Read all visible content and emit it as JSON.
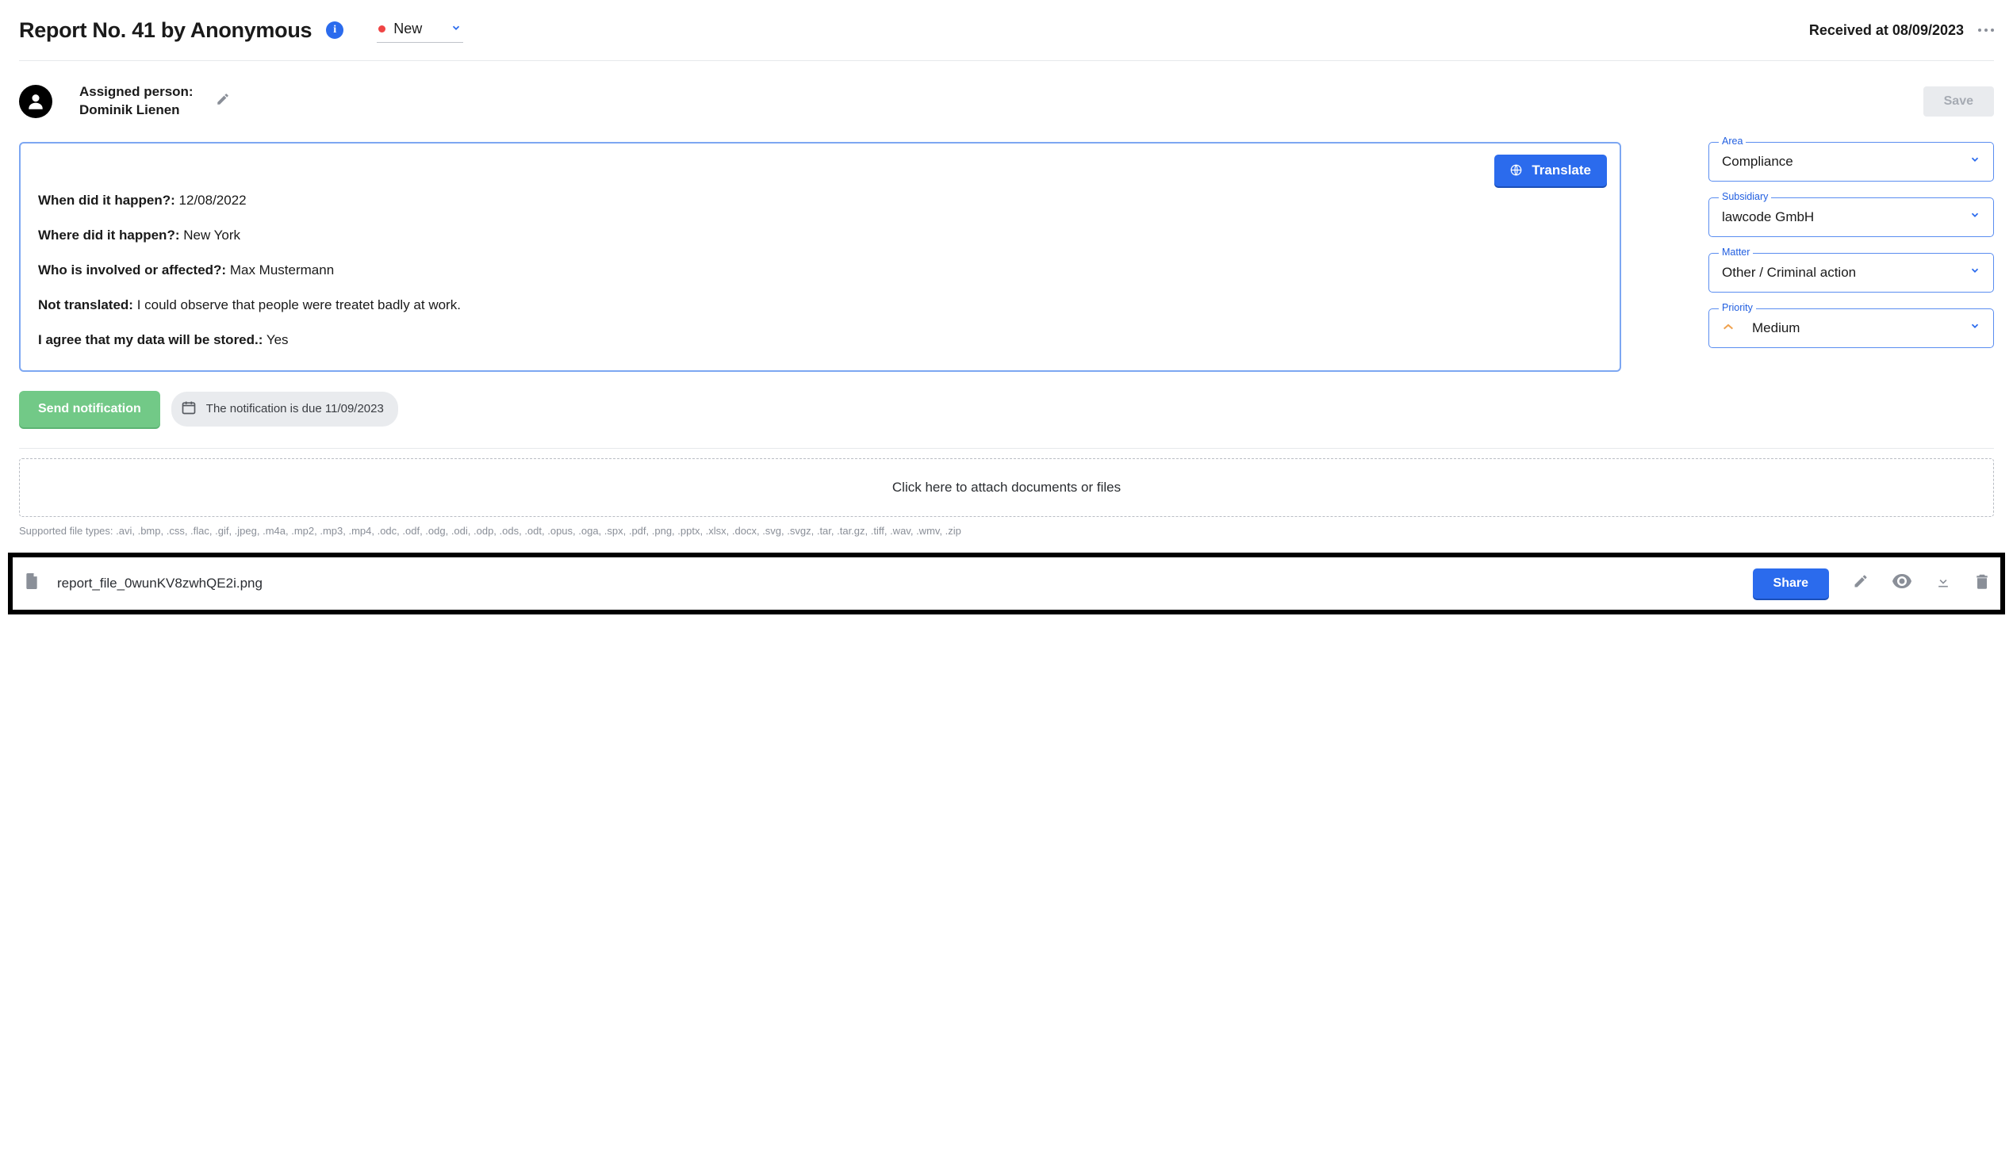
{
  "header": {
    "title": "Report No. 41 by Anonymous",
    "status_label": "New",
    "received_prefix": "Received at ",
    "received_date": "08/09/2023"
  },
  "assignee": {
    "label": "Assigned person:",
    "name": "Dominik Lienen"
  },
  "actions": {
    "save": "Save",
    "translate": "Translate",
    "send_notification": "Send notification",
    "share": "Share"
  },
  "notification_due": {
    "text": "The notification is due 11/09/2023"
  },
  "content": {
    "when_label": "When did it happen?:",
    "when_value": "12/08/2022",
    "where_label": "Where did it happen?:",
    "where_value": "New York",
    "who_label": "Who is involved or affected?:",
    "who_value": "Max Mustermann",
    "nottr_label": "Not translated:",
    "nottr_value": "I could observe that people were treatet badly at work.",
    "consent_label": "I agree that my data will be stored.:",
    "consent_value": "Yes"
  },
  "selects": {
    "area": {
      "label": "Area",
      "value": "Compliance"
    },
    "subsidiary": {
      "label": "Subsidiary",
      "value": "lawcode GmbH"
    },
    "matter": {
      "label": "Matter",
      "value": "Other / Criminal action"
    },
    "priority": {
      "label": "Priority",
      "value": "Medium"
    }
  },
  "dropzone": {
    "text": "Click here to attach documents or files",
    "supported": "Supported file types: .avi, .bmp, .css, .flac, .gif, .jpeg, .m4a, .mp2, .mp3, .mp4, .odc, .odf, .odg, .odi, .odp, .ods, .odt, .opus, .oga, .spx, .pdf, .png, .pptx, .xlsx, .docx, .svg, .svgz, .tar, .tar.gz, .tiff, .wav, .wmv, .zip"
  },
  "attachment": {
    "filename": "report_file_0wunKV8zwhQE2i.png"
  },
  "icons": {
    "info": "info-icon",
    "chevron_down": "chevron-down-icon",
    "more": "more-horizontal-icon",
    "avatar": "person-icon",
    "edit": "pencil-icon",
    "globe": "globe-icon",
    "calendar": "calendar-icon",
    "priority": "chevron-up-icon",
    "file": "file-icon",
    "eye": "eye-icon",
    "download": "download-icon",
    "trash": "trash-icon"
  }
}
